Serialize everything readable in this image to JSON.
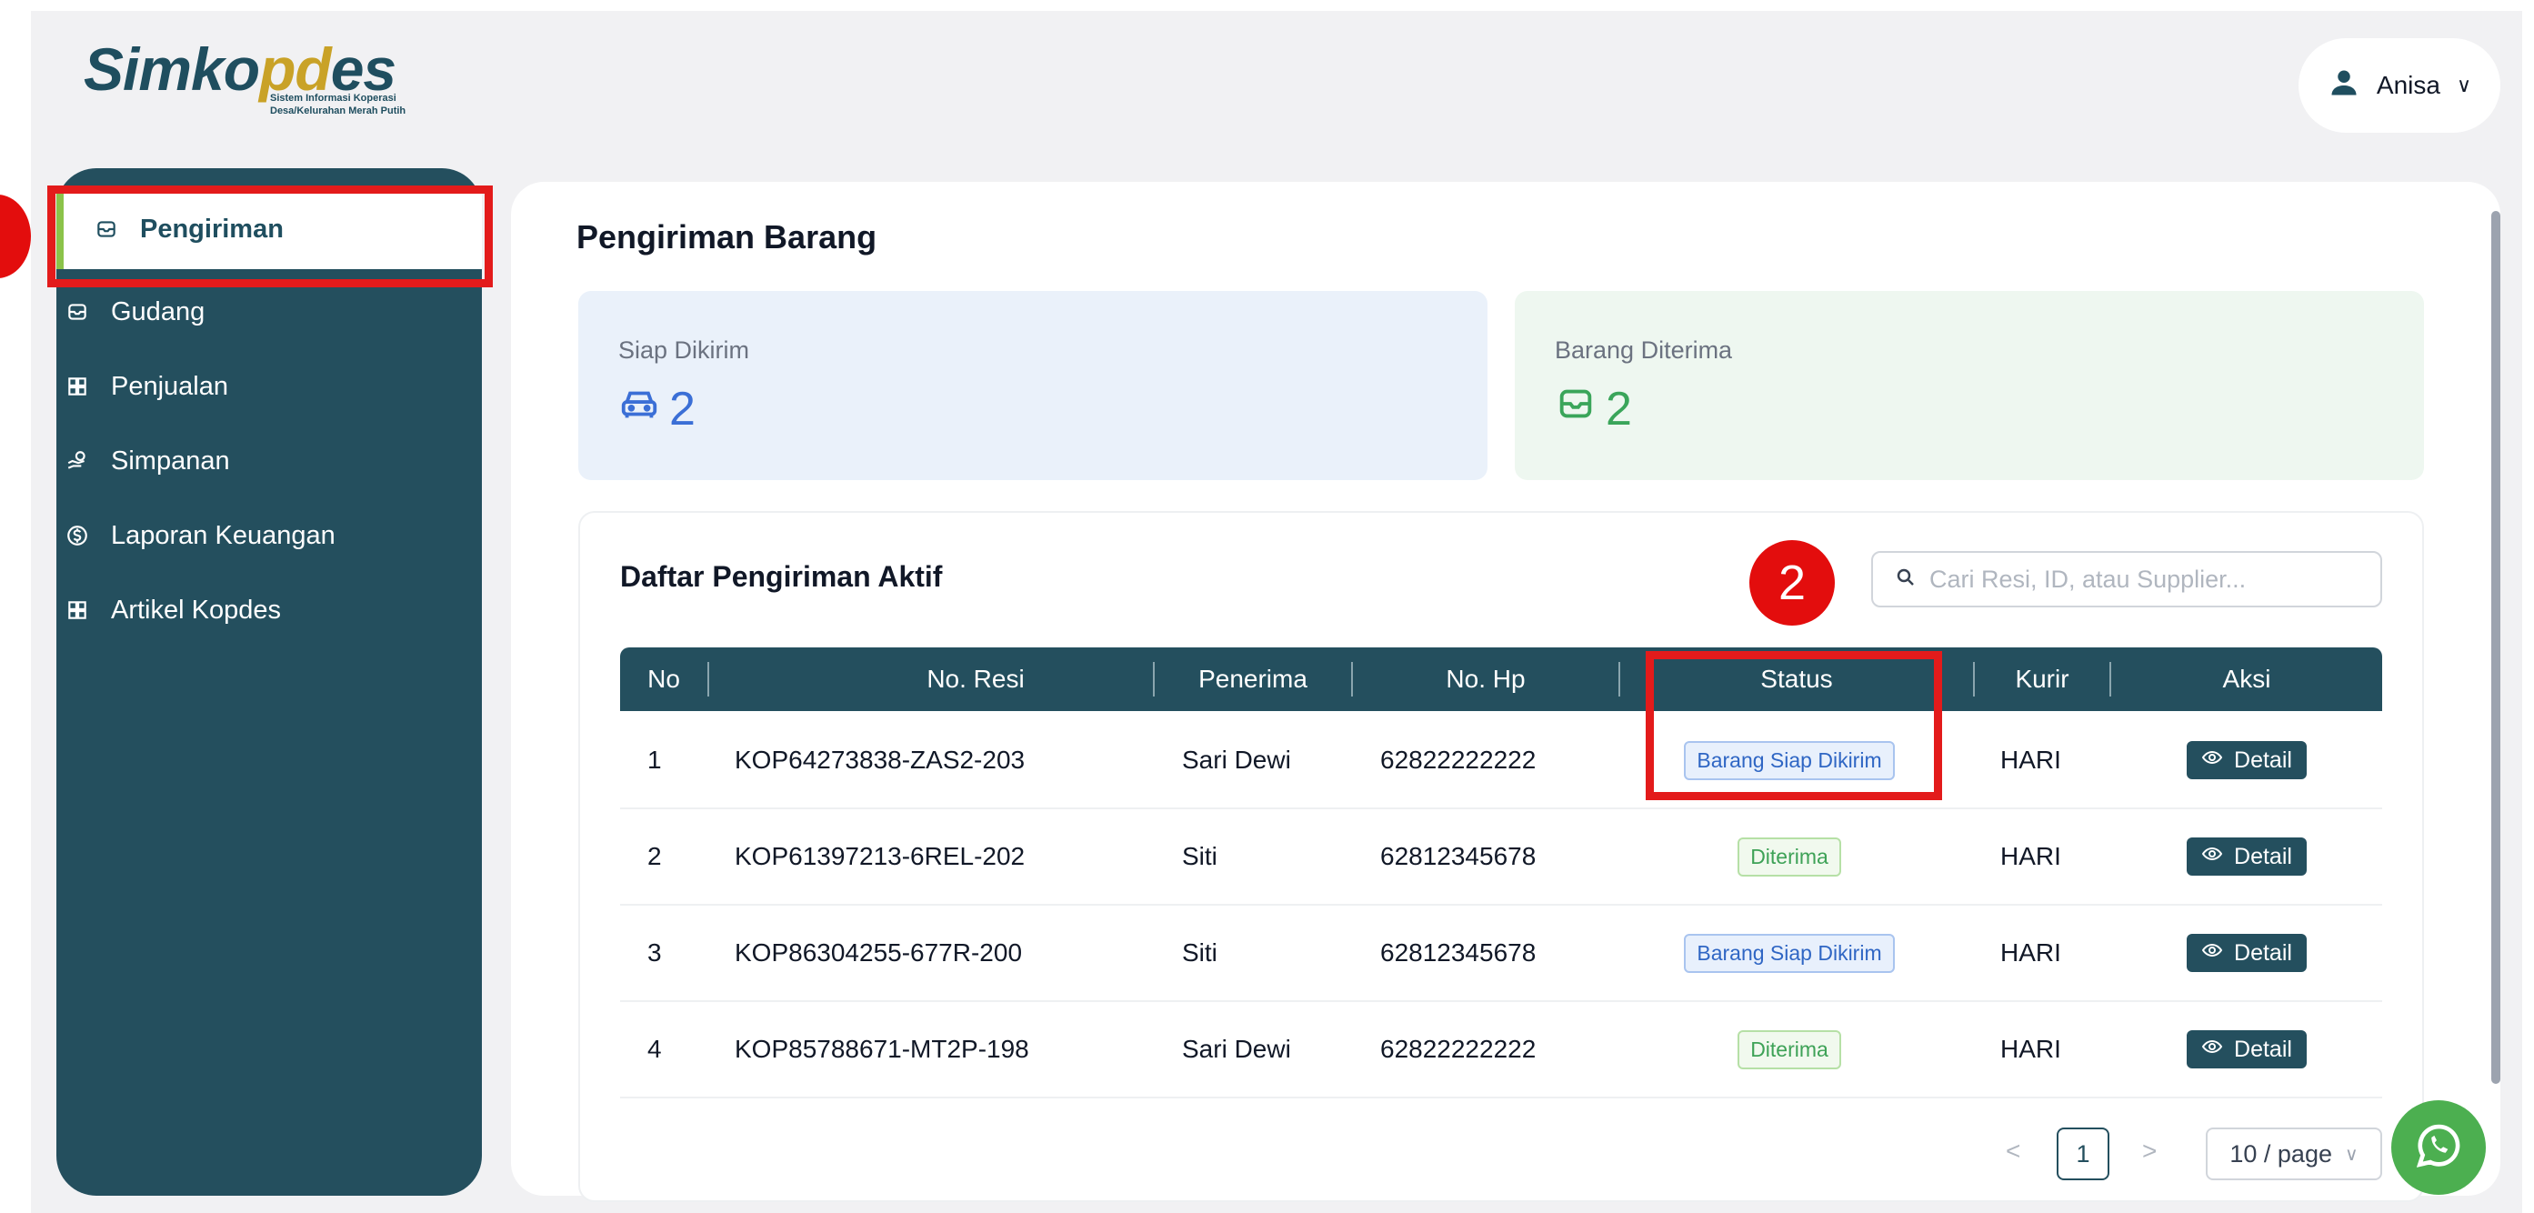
{
  "header": {
    "logo_text_1": "Simko",
    "logo_text_oo": "pd",
    "logo_text_2": "es",
    "logo_subtitle": "Sistem Informasi Koperasi Desa/Kelurahan Merah Putih",
    "user_name": "Anisa"
  },
  "sidebar": {
    "items": [
      {
        "label": "Pengiriman",
        "icon": "inbox-icon"
      },
      {
        "label": "Gudang",
        "icon": "inbox-icon"
      },
      {
        "label": "Penjualan",
        "icon": "grid-icon"
      },
      {
        "label": "Simpanan",
        "icon": "hand-coins-icon"
      },
      {
        "label": "Laporan Keuangan",
        "icon": "dollar-circle-icon"
      },
      {
        "label": "Artikel Kopdes",
        "icon": "grid-icon"
      }
    ]
  },
  "annotations": {
    "marker_2": "2"
  },
  "main": {
    "page_title": "Pengiriman Barang",
    "stats": [
      {
        "label": "Siap Dikirim",
        "value": "2",
        "color": "#3b6fd6"
      },
      {
        "label": "Barang Diterima",
        "value": "2",
        "color": "#3aa55a"
      }
    ],
    "list_title": "Daftar Pengiriman Aktif",
    "search_placeholder": "Cari Resi, ID, atau Supplier...",
    "columns": [
      "No",
      "No. Resi",
      "Penerima",
      "No. Hp",
      "Status",
      "Kurir",
      "Aksi"
    ],
    "rows": [
      {
        "no": "1",
        "resi": "KOP64273838-ZAS2-203",
        "penerima": "Sari Dewi",
        "hp": "62822222222",
        "status": "Barang Siap Dikirim",
        "kurir": "HARI",
        "aksi": "Detail"
      },
      {
        "no": "2",
        "resi": "KOP61397213-6REL-202",
        "penerima": "Siti",
        "hp": "62812345678",
        "status": "Diterima",
        "kurir": "HARI",
        "aksi": "Detail"
      },
      {
        "no": "3",
        "resi": "KOP86304255-677R-200",
        "penerima": "Siti",
        "hp": "62812345678",
        "status": "Barang Siap Dikirim",
        "kurir": "HARI",
        "aksi": "Detail"
      },
      {
        "no": "4",
        "resi": "KOP85788671-MT2P-198",
        "penerima": "Sari Dewi",
        "hp": "62822222222",
        "status": "Diterima",
        "kurir": "HARI",
        "aksi": "Detail"
      }
    ],
    "pagination": {
      "prev": "<",
      "current_page": "1",
      "next": ">",
      "page_size": "10 / page"
    }
  },
  "colors": {
    "sidebar": "#244f5e",
    "accent": "#8bc34a",
    "annotation": "#e31b1b",
    "whatsapp": "#4caf50"
  }
}
